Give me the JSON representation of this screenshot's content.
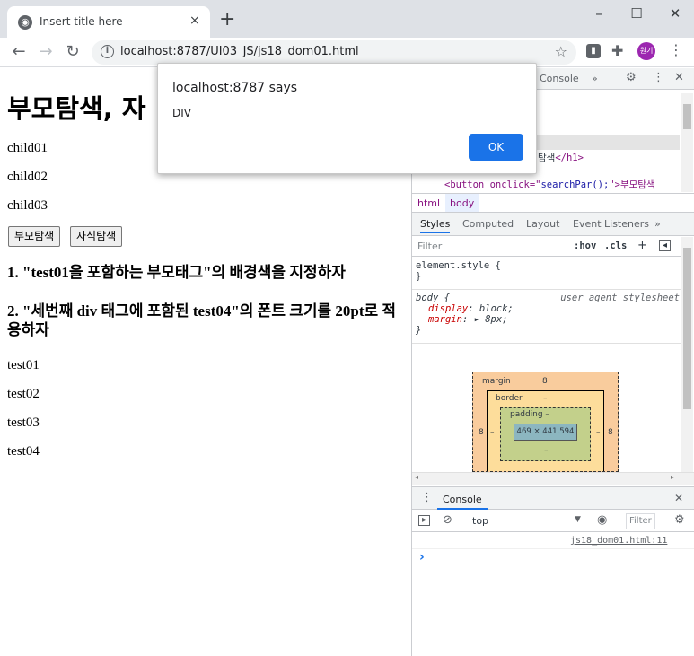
{
  "browser": {
    "tab_title": "Insert title here",
    "tab_close": "×",
    "new_tab": "+",
    "url": "localhost:8787/UI03_JS/js18_dom01.html",
    "profile_label": "원기",
    "window_controls": [
      "–",
      "☐",
      "✕"
    ]
  },
  "page": {
    "heading": "부모탐색, 자",
    "children": [
      "child01",
      "child02",
      "child03"
    ],
    "buttons": {
      "parent": "부모탐색",
      "child": "자식탐색"
    },
    "task1": "1. \"test01을 포함하는 부모태그\"의 배경색을 지정하자",
    "task2": "2. \"세번째 div 태그에 포함된 test04\"의 폰트 크기를 20pt로 적용하자",
    "tests": [
      "test01",
      "test02",
      "test03",
      "test04"
    ]
  },
  "dialog": {
    "title": "localhost:8787 says",
    "message": "DIV",
    "ok": "OK"
  },
  "devtools": {
    "top_tabs": {
      "console": "Console",
      "more": "»"
    },
    "elements": {
      "h1_tail_text": "탐색",
      "h1_close": "</h1>",
      "button_line_prefix": "<button onclick=\"",
      "button_line_attr": "searchPar();",
      "button_line_suffix": "\">부모탐색"
    },
    "breadcrumbs": [
      "html",
      "body"
    ],
    "style_tabs": [
      "Styles",
      "Computed",
      "Layout",
      "Event Listeners",
      "»"
    ],
    "filter_placeholder": "Filter",
    "hov": ":hov",
    "cls": ".cls",
    "element_style": "element.style {",
    "close_brace": "}",
    "rule_selector": "body {",
    "rule_source": "user agent stylesheet",
    "decls": [
      {
        "prop": "display",
        "value": "block;"
      },
      {
        "prop": "margin",
        "value": "▸ 8px;"
      }
    ],
    "box_model": {
      "margin_label": "margin",
      "margin_top": "8",
      "margin_left": "8",
      "margin_right": "8",
      "border_label": "border",
      "dash": "–",
      "padding_label": "padding –",
      "content_size": "469 × 441.594"
    },
    "console": {
      "title": "Console",
      "context": "top",
      "filter_placeholder": "Filter",
      "source_link": "js18_dom01.html:11",
      "prompt": "›"
    }
  }
}
